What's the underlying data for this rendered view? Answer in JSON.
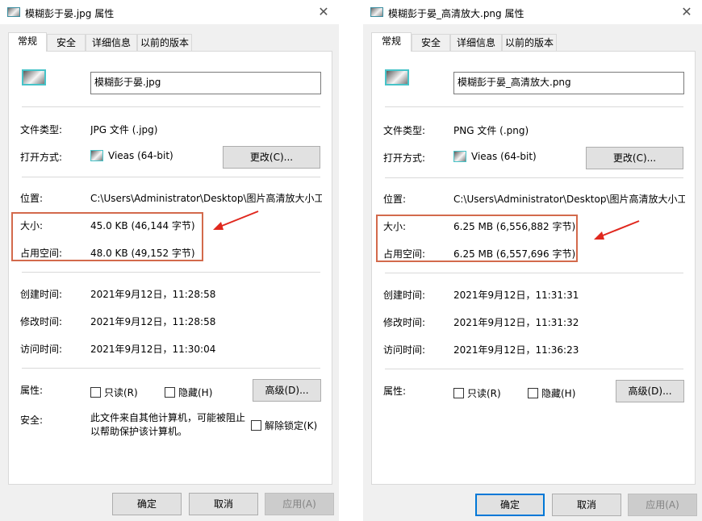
{
  "dialogs": [
    {
      "title": "模糊彭于晏.jpg 属性",
      "tabs": [
        "常规",
        "安全",
        "详细信息",
        "以前的版本"
      ],
      "filename": "模糊彭于晏.jpg",
      "file_type_label": "文件类型:",
      "file_type": "JPG 文件 (.jpg)",
      "open_with_label": "打开方式:",
      "open_with": "Vieas (64-bit)",
      "change_button": "更改(C)...",
      "location_label": "位置:",
      "location": "C:\\Users\\Administrator\\Desktop\\图片高清放大小工",
      "size_label": "大小:",
      "size": "45.0 KB (46,144 字节)",
      "disk_size_label": "占用空间:",
      "disk_size": "48.0 KB (49,152 字节)",
      "created_label": "创建时间:",
      "created": "2021年9月12日，11:28:58",
      "modified_label": "修改时间:",
      "modified": "2021年9月12日，11:28:58",
      "accessed_label": "访问时间:",
      "accessed": "2021年9月12日，11:30:04",
      "attributes_label": "属性:",
      "readonly_label": "只读(R)",
      "hidden_label": "隐藏(H)",
      "advanced_button": "高级(D)...",
      "security_label": "安全:",
      "security_line1": "此文件来自其他计算机，可能被阻止",
      "security_line2": "以帮助保护该计算机。",
      "unblock_label": "解除锁定(K)",
      "ok_button": "确定",
      "cancel_button": "取消",
      "apply_button": "应用(A)"
    },
    {
      "title": "模糊彭于晏_高清放大.png 属性",
      "tabs": [
        "常规",
        "安全",
        "详细信息",
        "以前的版本"
      ],
      "filename": "模糊彭于晏_高清放大.png",
      "file_type_label": "文件类型:",
      "file_type": "PNG 文件 (.png)",
      "open_with_label": "打开方式:",
      "open_with": "Vieas (64-bit)",
      "change_button": "更改(C)...",
      "location_label": "位置:",
      "location": "C:\\Users\\Administrator\\Desktop\\图片高清放大小工",
      "size_label": "大小:",
      "size": "6.25 MB (6,556,882 字节)",
      "disk_size_label": "占用空间:",
      "disk_size": "6.25 MB (6,557,696 字节)",
      "created_label": "创建时间:",
      "created": "2021年9月12日，11:31:31",
      "modified_label": "修改时间:",
      "modified": "2021年9月12日，11:31:32",
      "accessed_label": "访问时间:",
      "accessed": "2021年9月12日，11:36:23",
      "attributes_label": "属性:",
      "readonly_label": "只读(R)",
      "hidden_label": "隐藏(H)",
      "advanced_button": "高级(D)...",
      "ok_button": "确定",
      "cancel_button": "取消",
      "apply_button": "应用(A)"
    }
  ],
  "annotation_color": "#d36a4c",
  "arrow_color": "#e0281e",
  "icons": [
    "image-file-icon",
    "close-icon",
    "viewer-app-icon"
  ]
}
